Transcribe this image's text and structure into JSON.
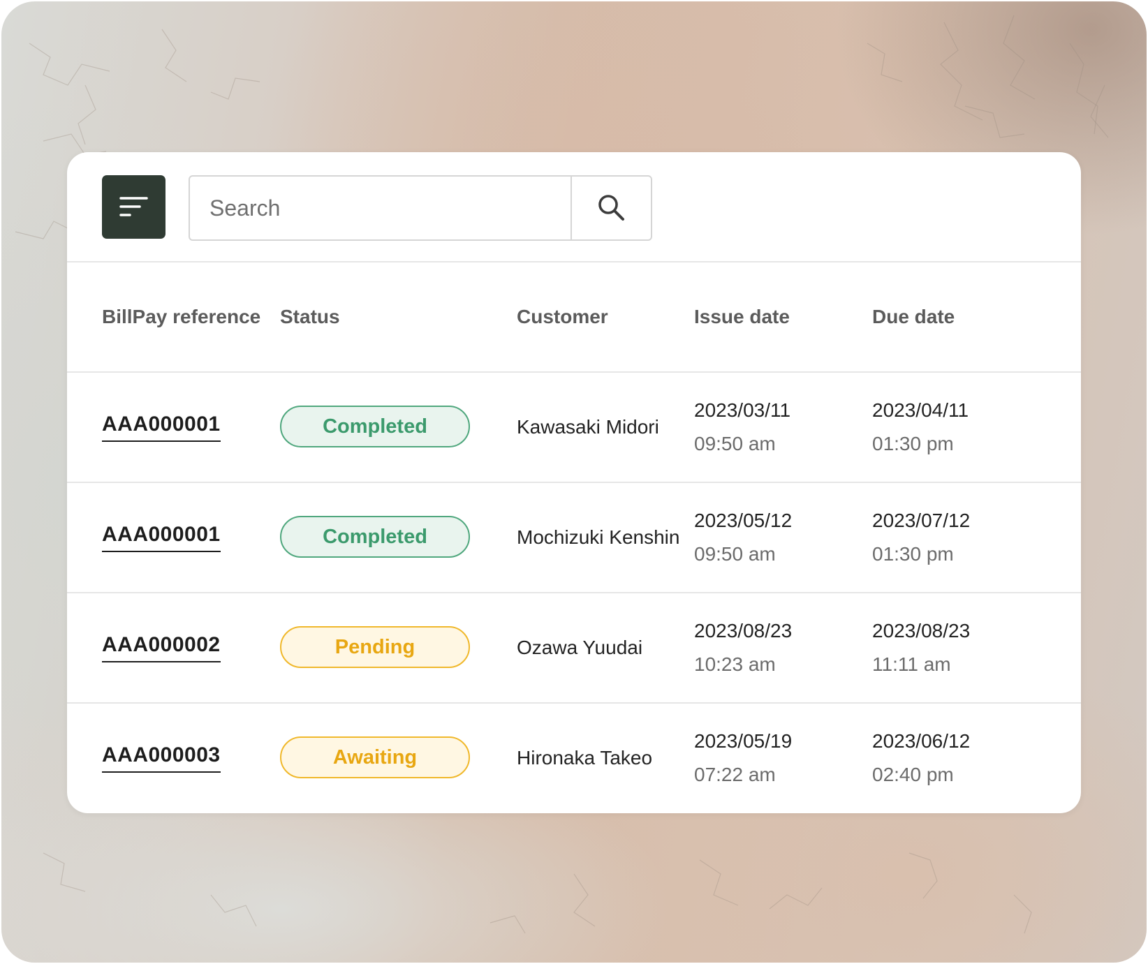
{
  "search": {
    "placeholder": "Search"
  },
  "columns": [
    "BillPay reference",
    "Status",
    "Customer",
    "Issue date",
    "Due date"
  ],
  "rows": [
    {
      "reference": "AAA000001",
      "status": "Completed",
      "status_tone": "green",
      "customer": "Kawasaki Midori",
      "issue_date": "2023/03/11",
      "issue_time": "09:50 am",
      "due_date": "2023/04/11",
      "due_time": "01:30 pm"
    },
    {
      "reference": "AAA000001",
      "status": "Completed",
      "status_tone": "green",
      "customer": "Mochizuki Kenshin",
      "issue_date": "2023/05/12",
      "issue_time": "09:50 am",
      "due_date": "2023/07/12",
      "due_time": "01:30 pm"
    },
    {
      "reference": "AAA000002",
      "status": "Pending",
      "status_tone": "yellow",
      "customer": "Ozawa Yuudai",
      "issue_date": "2023/08/23",
      "issue_time": "10:23 am",
      "due_date": "2023/08/23",
      "due_time": "11:11 am"
    },
    {
      "reference": "AAA000003",
      "status": "Awaiting",
      "status_tone": "yellow",
      "customer": "Hironaka Takeo",
      "issue_date": "2023/05/19",
      "issue_time": "07:22 am",
      "due_date": "2023/06/12",
      "due_time": "02:40 pm"
    }
  ],
  "colors": {
    "filter_button": "#2f3b33",
    "badge_green_text": "#3b9a6c",
    "badge_green_bg": "#e9f4ee",
    "badge_yellow_text": "#e8a712",
    "badge_yellow_bg": "#fff7e3"
  },
  "icons": {
    "filter": "filter-lines-icon",
    "search": "magnifier-icon"
  }
}
